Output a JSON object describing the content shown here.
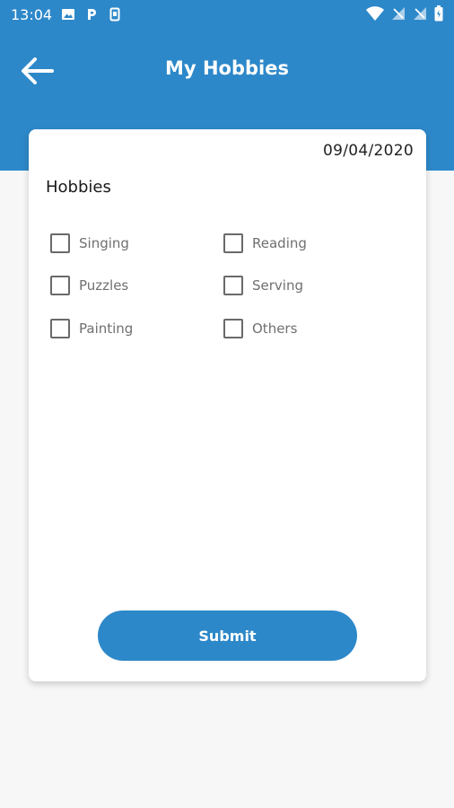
{
  "status_bar": {
    "time": "13:04",
    "left_icons": [
      "image-icon",
      "parking-icon",
      "sim-icon"
    ],
    "right_icons": [
      "wifi-icon",
      "no-signal-icon",
      "no-signal-icon",
      "battery-icon"
    ]
  },
  "app_bar": {
    "title": "My Hobbies",
    "back_icon": "arrow-left-icon"
  },
  "card": {
    "date": "09/04/2020",
    "section_title": "Hobbies",
    "hobbies": [
      {
        "label": "Singing",
        "checked": false
      },
      {
        "label": "Reading",
        "checked": false
      },
      {
        "label": "Puzzles",
        "checked": false
      },
      {
        "label": "Serving",
        "checked": false
      },
      {
        "label": "Painting",
        "checked": false
      },
      {
        "label": "Others",
        "checked": false
      }
    ],
    "submit_label": "Submit"
  },
  "colors": {
    "primary": "#2d88c9",
    "background": "#f7f7f7",
    "card": "#ffffff"
  }
}
